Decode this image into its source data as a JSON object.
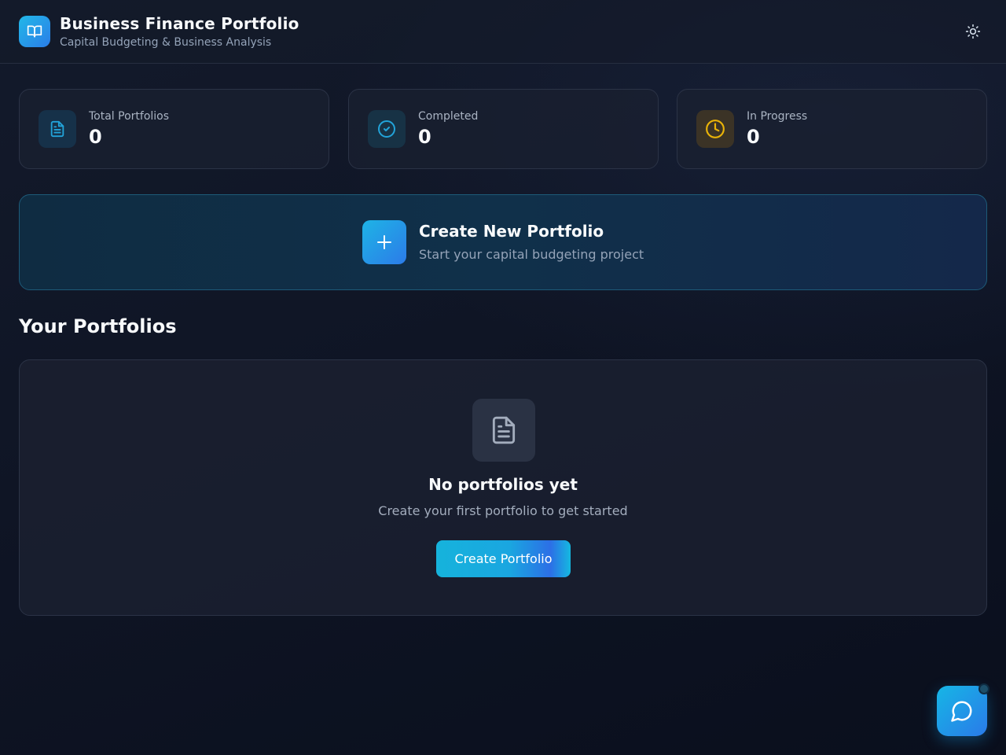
{
  "header": {
    "title": "Business Finance Portfolio",
    "subtitle": "Capital Budgeting & Business Analysis",
    "logo_icon": "book-open-icon",
    "theme_icon": "sun-icon"
  },
  "stats": [
    {
      "label": "Total Portfolios",
      "value": "0",
      "icon": "file-text-icon",
      "color": "#22a3d9"
    },
    {
      "label": "Completed",
      "value": "0",
      "icon": "check-circle-icon",
      "color": "#22a3d9"
    },
    {
      "label": "In Progress",
      "value": "0",
      "icon": "clock-icon",
      "color": "#eab308"
    }
  ],
  "create_card": {
    "title": "Create New Portfolio",
    "subtitle": "Start your capital budgeting project",
    "icon": "plus-icon"
  },
  "portfolios": {
    "section_title": "Your Portfolios",
    "empty_title": "No portfolios yet",
    "empty_subtitle": "Create your first portfolio to get started",
    "create_button": "Create Portfolio",
    "empty_icon": "file-text-icon"
  },
  "chat": {
    "icon": "message-circle-icon"
  },
  "colors": {
    "accent": "#1eb4e6",
    "accent_blue": "#2a7de8",
    "warning": "#eab308",
    "background": "#0d1322"
  }
}
